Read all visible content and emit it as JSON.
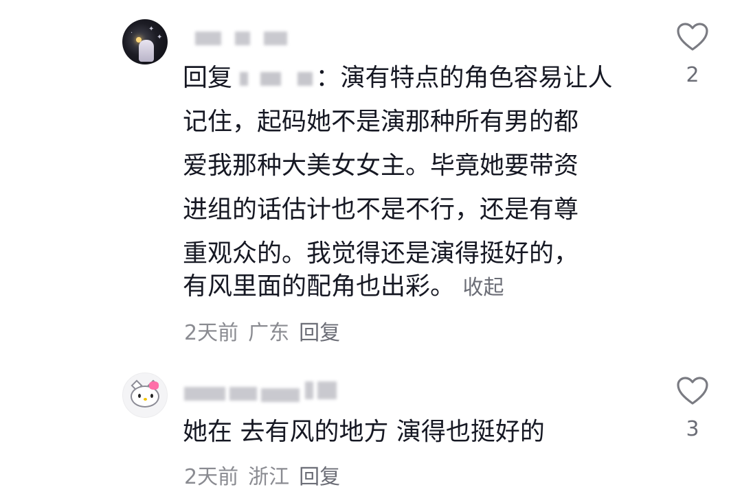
{
  "comments": [
    {
      "reply_prefix": "回复",
      "lines": [
        "：演有特点的角色容易让人",
        "记住，起码她不是演那种所有男的都",
        "爱我那种大美女女主。毕竟她要带资",
        "进组的话估计也不是不行，还是有尊",
        "重观众的。我觉得还是演得挺好的，",
        "有风里面的配角也出彩。"
      ],
      "collapse_label": "收起",
      "time": "2天前",
      "location": "广东",
      "reply_label": "回复",
      "like_count": "2",
      "like_icon": "heart-outline-icon"
    },
    {
      "lines": [
        "她在 去有风的地方 演得也挺好的"
      ],
      "time": "2天前",
      "location": "浙江",
      "reply_label": "回复",
      "like_count": "3",
      "like_icon": "heart-outline-icon"
    }
  ],
  "colors": {
    "text": "#161823",
    "meta": "#8a8b91",
    "accent_muted": "#6b6d76"
  }
}
